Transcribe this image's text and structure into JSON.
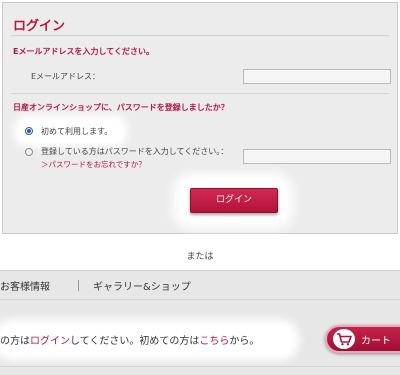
{
  "login_form": {
    "title": "ログイン",
    "email_heading": "Eメールアドレスを入力してください。",
    "email_label": "Eメールアドレス：",
    "email_value": "",
    "password_heading": "日産オンラインショップに、パスワードを登録しましたか？",
    "option_first_label": "初めて利用します。",
    "option_first_selected": true,
    "option_registered_label": "登録している方はパスワードを入力してください。：",
    "option_registered_selected": false,
    "forgot_password_link": "＞パスワードをお忘れですか？",
    "password_value": "",
    "login_button_label": "ログイン"
  },
  "separator_text": "または",
  "header": {
    "nav_items": [
      "お客様情報",
      "ギャラリー&ショップ"
    ],
    "notice": {
      "prefix": "の方は",
      "login_link": "ログイン",
      "middle": "してください。初めての方は",
      "here_link": "こちら",
      "suffix": "から。"
    },
    "cart_label": "カート"
  },
  "colors": {
    "accent": "#b8163d",
    "panel_bg": "#ececec",
    "header_bg": "#e7e7e7",
    "radio_selected": "#2d5fa8"
  },
  "icons": {
    "cart": "shopping-cart-icon"
  }
}
